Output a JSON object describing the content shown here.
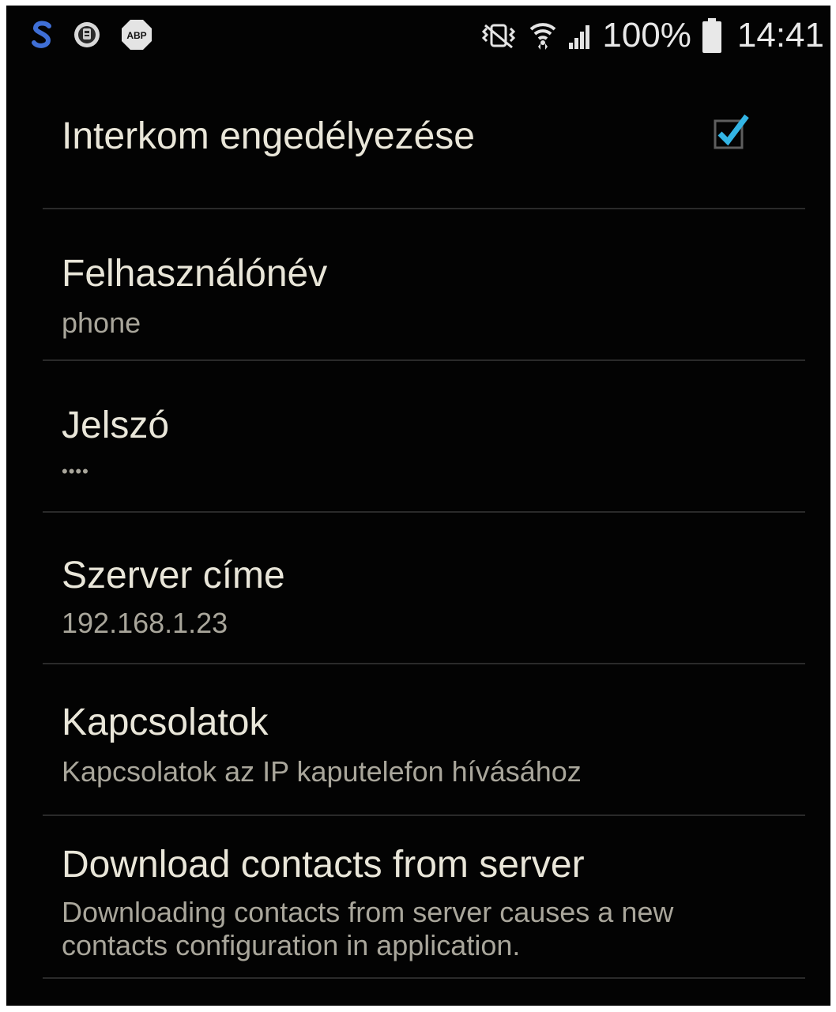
{
  "status_bar": {
    "left_icons": [
      "skype-icon",
      "app-badge-icon",
      "adblock-plus-icon"
    ],
    "adblock_label": "ABP",
    "right_icons": [
      "mute-vibrate-icon",
      "wifi-icon",
      "signal-icon"
    ],
    "battery": "100%",
    "time": "14:41"
  },
  "colors": {
    "background": "#030303",
    "title_text": "#e9e6d9",
    "summary_text": "#a9a69b",
    "divider": "#2a2a2a",
    "checkbox_accent": "#33b5e5"
  },
  "settings": {
    "intercom": {
      "title": "Interkom engedélyezése",
      "checked": true
    },
    "username": {
      "title": "Felhasználónév",
      "summary": "phone"
    },
    "password": {
      "title": "Jelszó",
      "summary": "••••"
    },
    "server": {
      "title": "Szerver címe",
      "summary": "192.168.1.23"
    },
    "contacts": {
      "title": "Kapcsolatok",
      "summary": "Kapcsolatok az IP kaputelefon hívásához"
    },
    "download": {
      "title": "Download contacts from server",
      "summary_line1": "Downloading contacts from server causes a new",
      "summary_line2": "contacts configuration in application."
    }
  }
}
